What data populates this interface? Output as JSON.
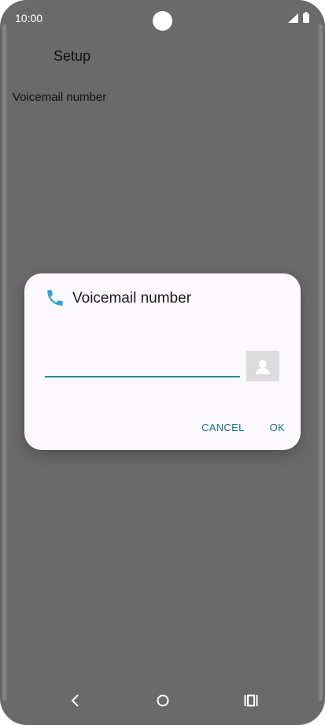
{
  "status": {
    "time": "10:00"
  },
  "header": {
    "title": "Setup"
  },
  "setting": {
    "label": "Voicemail number"
  },
  "dialog": {
    "title": "Voicemail number",
    "input": {
      "value": "",
      "placeholder": ""
    },
    "cancel_label": "CANCEL",
    "ok_label": "OK"
  },
  "icons": {
    "dialog": "phone-icon",
    "contact": "contact-icon",
    "nav": [
      "back-icon",
      "home-icon",
      "recents-icon"
    ]
  },
  "colors": {
    "accent": "#1a8f8a",
    "action_text": "#1f6f92",
    "phone_icon": "#2aa5d8",
    "background": "#6a6a6a"
  }
}
